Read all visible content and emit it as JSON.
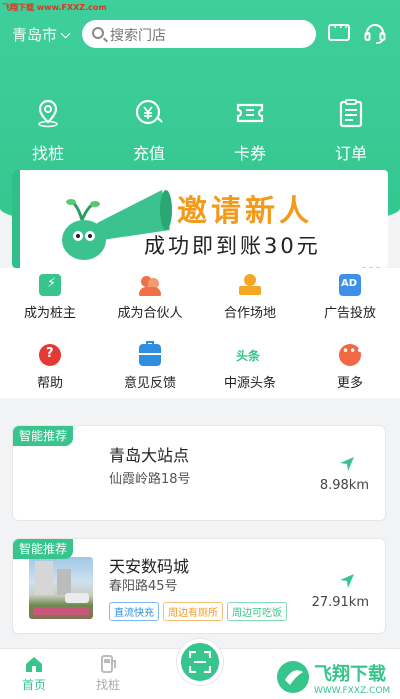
{
  "watermark": "飞翔下载 www.FXXZ.com",
  "topbar": {
    "city": "青岛市",
    "search_placeholder": "搜索门店"
  },
  "quick_actions": [
    {
      "label": "找桩"
    },
    {
      "label": "充值"
    },
    {
      "label": "卡券"
    },
    {
      "label": "订单"
    }
  ],
  "banner": {
    "headline": "邀请新人",
    "subline": "成功即到账30元"
  },
  "grid": [
    {
      "label": "成为桩主",
      "color": "#36c58c"
    },
    {
      "label": "成为合伙人",
      "color": "#f07048"
    },
    {
      "label": "合作场地",
      "color": "#f5a623"
    },
    {
      "label": "广告投放",
      "color": "#3d8fe8"
    },
    {
      "label": "帮助",
      "color": "#e53935"
    },
    {
      "label": "意见反馈",
      "color": "#2f8ee0"
    },
    {
      "label": "中源头条",
      "color": "#36c58c",
      "icon_text": "头条"
    },
    {
      "label": "更多",
      "color": "#f06845"
    }
  ],
  "stations": [
    {
      "tag": "智能推荐",
      "name": "青岛大站点",
      "address": "仙霞岭路18号",
      "distance": "8.98km"
    },
    {
      "tag": "智能推荐",
      "name": "天安数码城",
      "address": "春阳路45号",
      "distance": "27.91km",
      "chips": [
        "直流快充",
        "周边有厕所",
        "周边可吃饭"
      ]
    }
  ],
  "bottom_tabs": {
    "home": "首页",
    "find": "找桩"
  },
  "brand_logo": {
    "text": "飞翔下载",
    "url": "WWW.FXXZ.COM"
  },
  "colors": {
    "primary": "#37c58d",
    "accent": "#f39a1a"
  }
}
